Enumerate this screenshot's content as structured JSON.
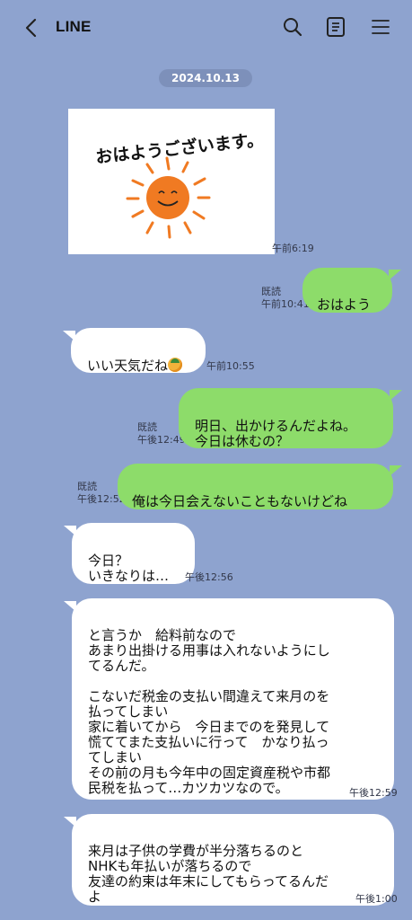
{
  "header": {
    "title": "LINE",
    "icons": [
      "back-chevron-icon",
      "search-icon",
      "notes-icon",
      "menu-icon"
    ]
  },
  "date_label": "2024.10.13",
  "sticker": {
    "text": "おはようございます。",
    "time": "午前6:19"
  },
  "messages": [
    {
      "side": "out",
      "text": "おはよう",
      "read": "既読",
      "time": "午前10:41"
    },
    {
      "side": "in",
      "text": "いい天気だね",
      "emoji": "sun-with-hat-emoji",
      "time": "午前10:55"
    },
    {
      "side": "out",
      "text": "明日、出かけるんだよね。\n今日は休むの？",
      "read": "既読",
      "time": "午後12:49"
    },
    {
      "side": "out",
      "text": "俺は今日会えないこともないけどね",
      "read": "既読",
      "time": "午後12:52"
    },
    {
      "side": "in",
      "text": "今日？\nいきなりは…",
      "time": "午後12:56"
    },
    {
      "side": "in",
      "text": "と言うか　給料前なので\nあまり出掛ける用事は入れないようにし\nてるんだ。\n\nこないだ税金の支払い間違えて来月のを\n払ってしまい\n家に着いてから　今日までのを発見して\n慌ててまた支払いに行って　かなり払っ\nてしまい\nその前の月も今年中の固定資産税や市都\n民税を払って…カツカツなので。",
      "time": "午後12:59"
    },
    {
      "side": "in",
      "text": "来月は子供の学費が半分落ちるのと\nNHKも年払いが落ちるので\n友達の約束は年末にしてもらってるんだ\nよ",
      "time": "午後1:00"
    }
  ],
  "colors": {
    "background": "#8ea3cf",
    "out_bubble": "#8ddc6a",
    "in_bubble": "#ffffff",
    "sticker_sun": "#f07a22"
  }
}
